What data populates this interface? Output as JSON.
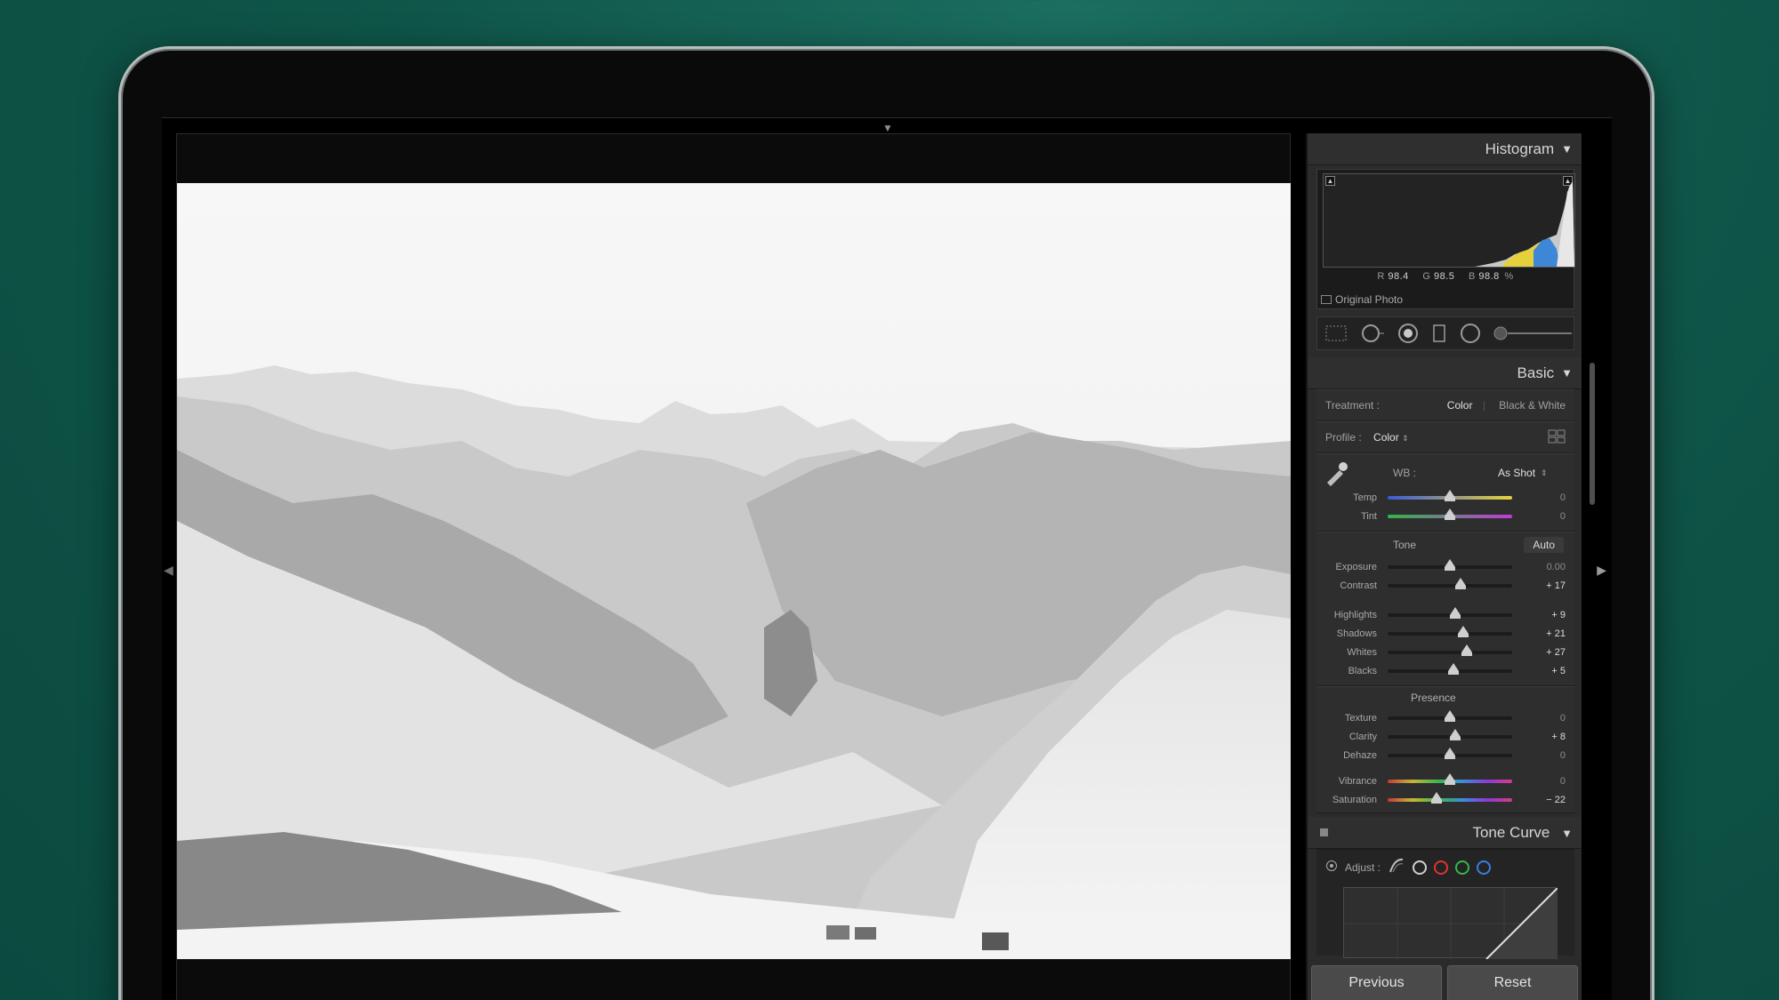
{
  "colors": {
    "background": "#0f5548",
    "panel": "#2b2b2b",
    "led": "#18d04f",
    "temp_gradient": [
      "#3a5bd8",
      "#e8d23a"
    ],
    "tint_gradient": [
      "#2fb64a",
      "#c23ad6"
    ]
  },
  "histogram": {
    "title": "Histogram",
    "r_label": "R",
    "r_value": "98.4",
    "g_label": "G",
    "g_value": "98.5",
    "b_label": "B",
    "b_value": "98.8",
    "percent": "%",
    "original_photo": "Original Photo"
  },
  "basic": {
    "title": "Basic",
    "treatment_label": "Treatment :",
    "treatment_color": "Color",
    "treatment_bw": "Black & White",
    "profile_label": "Profile :",
    "profile_value": "Color",
    "wb_label": "WB :",
    "wb_value": "As Shot",
    "temp": {
      "label": "Temp",
      "value": "0",
      "level": 0.5
    },
    "tint": {
      "label": "Tint",
      "value": "0",
      "level": 0.5
    },
    "tone_label": "Tone",
    "auto_label": "Auto",
    "exposure": {
      "label": "Exposure",
      "value": "0.00",
      "level": 0.5
    },
    "contrast": {
      "label": "Contrast",
      "value": "+ 17",
      "level": 0.585
    },
    "highlights": {
      "label": "Highlights",
      "value": "+ 9",
      "level": 0.545
    },
    "shadows": {
      "label": "Shadows",
      "value": "+ 21",
      "level": 0.605
    },
    "whites": {
      "label": "Whites",
      "value": "+ 27",
      "level": 0.635
    },
    "blacks": {
      "label": "Blacks",
      "value": "+ 5",
      "level": 0.525
    },
    "presence_label": "Presence",
    "texture": {
      "label": "Texture",
      "value": "0",
      "level": 0.5
    },
    "clarity": {
      "label": "Clarity",
      "value": "+ 8",
      "level": 0.54
    },
    "dehaze": {
      "label": "Dehaze",
      "value": "0",
      "level": 0.5
    },
    "vibrance": {
      "label": "Vibrance",
      "value": "0",
      "level": 0.5
    },
    "saturation": {
      "label": "Saturation",
      "value": "− 22",
      "level": 0.39
    }
  },
  "tone_curve": {
    "title": "Tone Curve",
    "adjust_label": "Adjust :"
  },
  "buttons": {
    "previous": "Previous",
    "reset": "Reset"
  }
}
